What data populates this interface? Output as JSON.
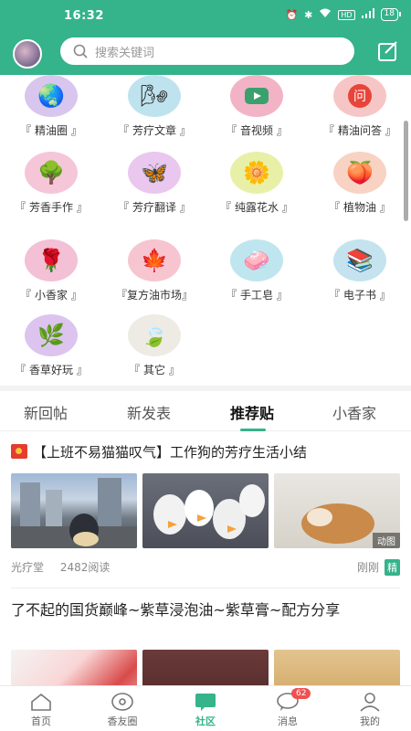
{
  "status": {
    "time": "16:32",
    "battery": "18",
    "signal_text": "HD"
  },
  "search": {
    "placeholder": "搜索关键词"
  },
  "categories": [
    {
      "label": "『 精油圈 』",
      "icon": "globe-icon",
      "color": "#d8c6ee"
    },
    {
      "label": "『 芳疗文章 』",
      "icon": "windmill-icon",
      "color": "#bfe3ee"
    },
    {
      "label": "『 音视频 』",
      "icon": "video-icon",
      "color": "#f3b3c6"
    },
    {
      "label": "『 精油问答 』",
      "icon": "qa-icon",
      "color": "#f6c6c6"
    },
    {
      "label": "『 芳香手作 』",
      "icon": "tree-icon",
      "color": "#f4c6d8"
    },
    {
      "label": "『 芳疗翻译 』",
      "icon": "butterfly-icon",
      "color": "#eac7ee"
    },
    {
      "label": "『 纯露花水 』",
      "icon": "flower-icon",
      "color": "#e8f0a8"
    },
    {
      "label": "『 植物油 』",
      "icon": "peach-icon",
      "color": "#f8d2c2"
    },
    {
      "label": "『 小香家 』",
      "icon": "rose-icon",
      "color": "#f3c0d6"
    },
    {
      "label": "『复方油市场』",
      "icon": "maple-leaf-icon",
      "color": "#f7c5d0"
    },
    {
      "label": "『 手工皂 』",
      "icon": "soap-icon",
      "color": "#bfe6ee"
    },
    {
      "label": "『 电子书 』",
      "icon": "books-icon",
      "color": "#c4e3ef"
    },
    {
      "label": "『 香草好玩 』",
      "icon": "herb-icon",
      "color": "#dcc4ef"
    },
    {
      "label": "『 其它 』",
      "icon": "leaf-icon",
      "color": "#eeeae4"
    }
  ],
  "tabs": [
    "新回帖",
    "新发表",
    "推荐贴",
    "小香家"
  ],
  "posts": [
    {
      "title": "【上班不易猫猫叹气】工作狗的芳疗生活小结",
      "author": "光疗堂",
      "reads": "2482阅读",
      "time": "刚刚",
      "badge": "精",
      "gif_label": "动图"
    },
    {
      "title": "了不起的国货巅峰~紫草浸泡油~紫草膏~配方分享"
    }
  ],
  "nav": [
    {
      "label": "首页"
    },
    {
      "label": "香友圈"
    },
    {
      "label": "社区"
    },
    {
      "label": "消息",
      "badge": "62"
    },
    {
      "label": "我的"
    }
  ],
  "colors": {
    "brand": "#35b38b",
    "badge_red": "#f05050"
  }
}
